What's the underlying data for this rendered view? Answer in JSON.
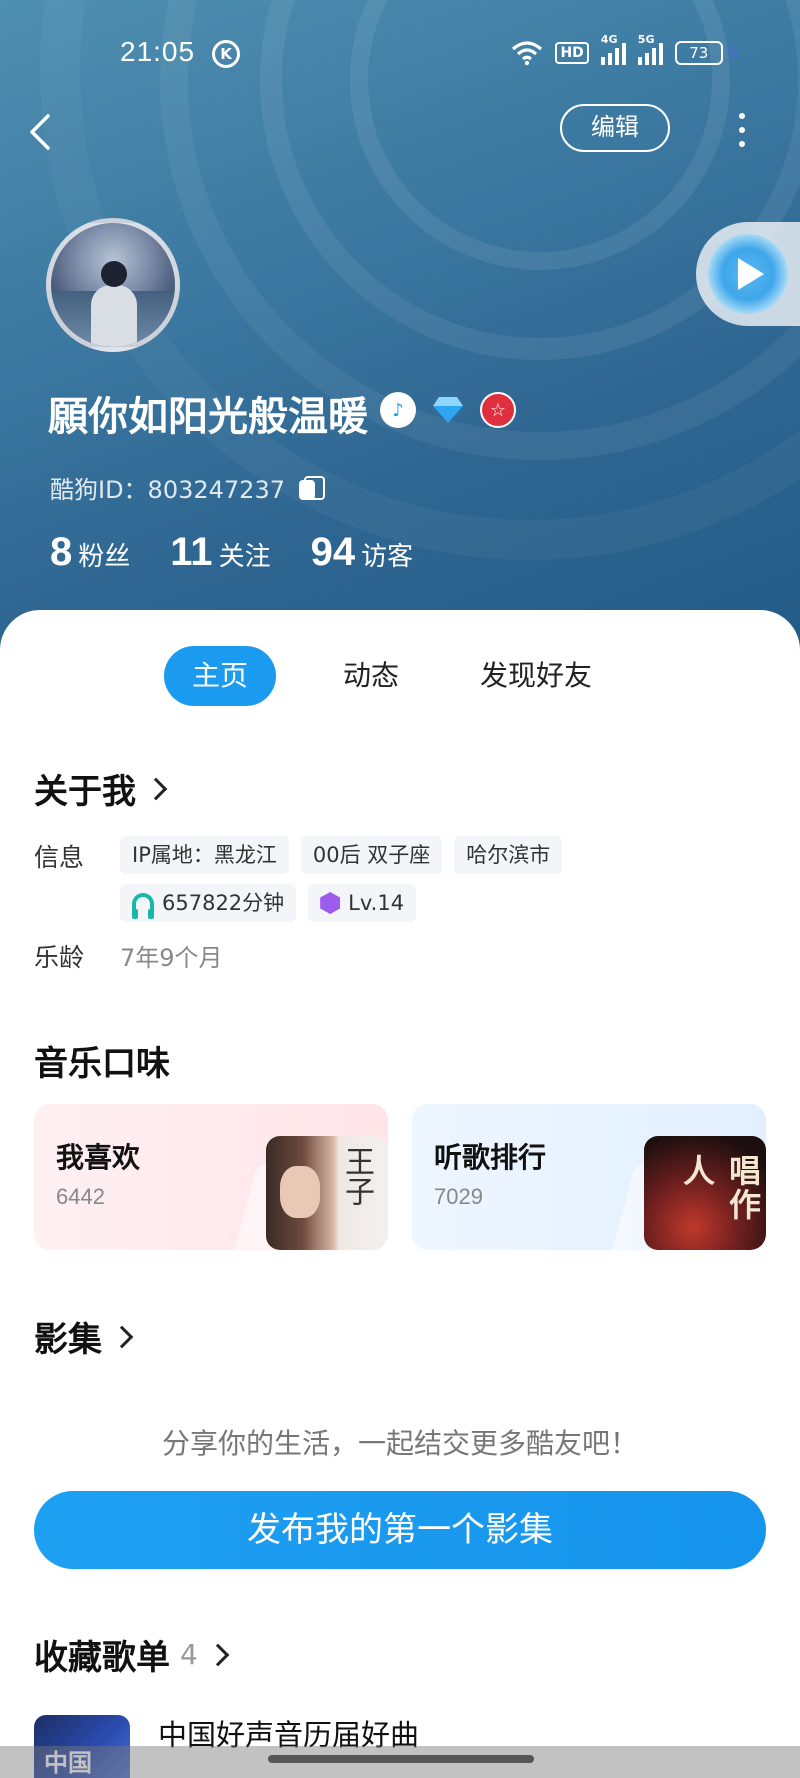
{
  "status_bar": {
    "time": "21:05",
    "hd_label": "HD",
    "net_4g": "4G",
    "net_5g": "5G",
    "battery": "73"
  },
  "nav": {
    "edit_label": "编辑"
  },
  "profile": {
    "username": "願你如阳光般温暖",
    "id_text": "酷狗ID：803247237",
    "stats": [
      {
        "num": "8",
        "label": "粉丝"
      },
      {
        "num": "11",
        "label": "关注"
      },
      {
        "num": "94",
        "label": "访客"
      }
    ]
  },
  "tabs": [
    {
      "label": "主页",
      "active": true
    },
    {
      "label": "动态",
      "active": false
    },
    {
      "label": "发现好友",
      "active": false
    }
  ],
  "about": {
    "title": "关于我",
    "info_label": "信息",
    "chips_row1": [
      "IP属地：黑龙江",
      "00后 双子座",
      "哈尔滨市"
    ],
    "listen_time": "657822分钟",
    "level": "Lv.14",
    "age_label": "乐龄",
    "age_value": "7年9个月"
  },
  "music_taste": {
    "title": "音乐口味",
    "cards": [
      {
        "title": "我喜欢",
        "count": "6442",
        "cover_text": "王子"
      },
      {
        "title": "听歌排行",
        "count": "7029",
        "cover_text": "唱作人"
      }
    ]
  },
  "gallery": {
    "title": "影集",
    "tip": "分享你的生活，一起结交更多酷友吧！",
    "button": "发布我的第一个影集"
  },
  "playlists": {
    "title": "收藏歌单",
    "count": "4",
    "items": [
      {
        "title": "中国好声音历届好曲"
      }
    ]
  },
  "colors": {
    "accent": "#1a9bf0",
    "header_top": "#4f8fb0",
    "header_bottom": "#245a86"
  }
}
